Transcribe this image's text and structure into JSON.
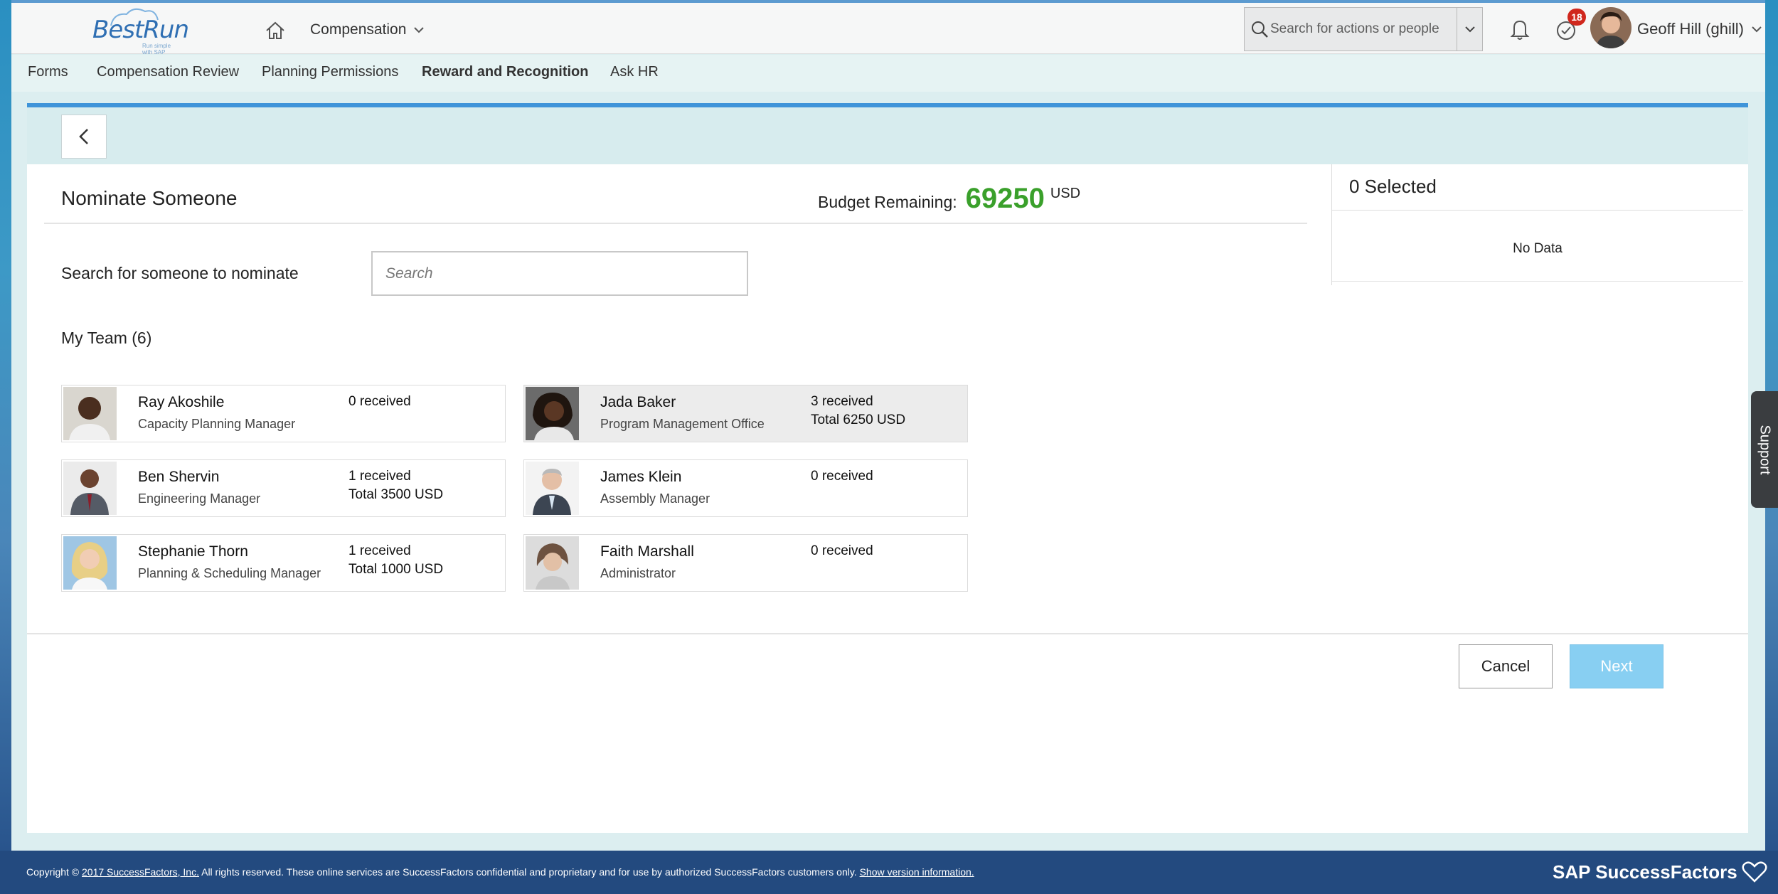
{
  "header": {
    "logo_text": "BestRun",
    "logo_tagline": "Run simple with SAP",
    "module_label": "Compensation",
    "search_placeholder": "Search for actions or people",
    "todo_badge": "18",
    "user_name": "Geoff Hill (ghill)"
  },
  "nav": {
    "items": [
      "Forms",
      "Compensation Review",
      "Planning Permissions",
      "Reward and Recognition",
      "Ask HR"
    ],
    "active": "Reward and Recognition"
  },
  "page": {
    "title": "Nominate Someone",
    "budget_label": "Budget Remaining:",
    "budget_amount": "69250",
    "budget_currency": "USD",
    "search_label": "Search for someone to nominate",
    "search_placeholder": "Search",
    "team_title": "My Team (6)"
  },
  "team": [
    {
      "name": "Ray Akoshile",
      "role": "Capacity Planning Manager",
      "received": "0 received",
      "total": ""
    },
    {
      "name": "Jada Baker",
      "role": "Program Management Office",
      "received": "3 received",
      "total": "Total 6250 USD"
    },
    {
      "name": "Ben Shervin",
      "role": "Engineering Manager",
      "received": "1 received",
      "total": "Total 3500 USD"
    },
    {
      "name": "James Klein",
      "role": "Assembly Manager",
      "received": "0 received",
      "total": ""
    },
    {
      "name": "Stephanie Thorn",
      "role": "Planning & Scheduling Manager",
      "received": "1 received",
      "total": "Total 1000 USD"
    },
    {
      "name": "Faith Marshall",
      "role": "Administrator",
      "received": "0 received",
      "total": ""
    }
  ],
  "selected_panel": {
    "count_label": "0 Selected",
    "empty_text": "No Data"
  },
  "actions": {
    "cancel_label": "Cancel",
    "next_label": "Next"
  },
  "support_label": "Support",
  "footer": {
    "copyright_prefix": "Copyright ©",
    "copyright_link": "2017 SuccessFactors, Inc.",
    "copyright_text": "All rights reserved. These online services are SuccessFactors confidential and proprietary and for use by authorized SuccessFactors customers only.",
    "version_link": "Show version information.",
    "brand": "SAP SuccessFactors"
  },
  "colors": {
    "accent_blue": "#3f94d9",
    "budget_green": "#3aa02b",
    "badge_red": "#d0271d",
    "next_disabled": "#88cff2"
  },
  "icons": [
    "home-icon",
    "chevron-down-icon",
    "search-icon",
    "bell-icon",
    "todo-check-icon",
    "back-chevron-icon",
    "heart-icon"
  ]
}
